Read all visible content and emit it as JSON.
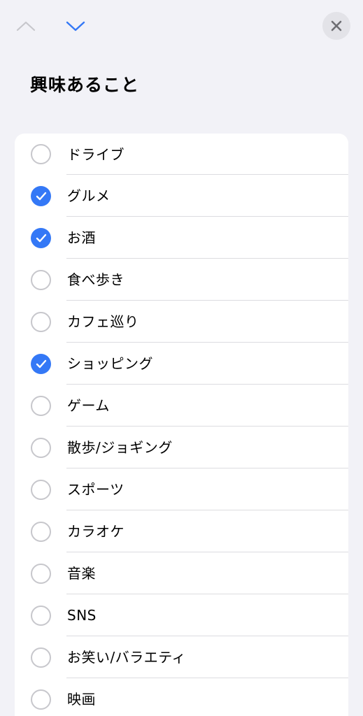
{
  "title": "興味あること",
  "nav": {
    "up_icon": "chevron-up-icon",
    "down_icon": "chevron-down-icon",
    "close_icon": "close-icon"
  },
  "colors": {
    "background": "#f2f2f7",
    "accent": "#3478f6",
    "chevron_disabled": "#c7c7cc",
    "card": "#ffffff"
  },
  "items": [
    {
      "label": "ドライブ",
      "checked": false
    },
    {
      "label": "グルメ",
      "checked": true
    },
    {
      "label": "お酒",
      "checked": true
    },
    {
      "label": "食べ歩き",
      "checked": false
    },
    {
      "label": "カフェ巡り",
      "checked": false
    },
    {
      "label": "ショッピング",
      "checked": true
    },
    {
      "label": "ゲーム",
      "checked": false
    },
    {
      "label": "散歩/ジョギング",
      "checked": false
    },
    {
      "label": "スポーツ",
      "checked": false
    },
    {
      "label": "カラオケ",
      "checked": false
    },
    {
      "label": "音楽",
      "checked": false
    },
    {
      "label": "SNS",
      "checked": false
    },
    {
      "label": "お笑い/バラエティ",
      "checked": false
    },
    {
      "label": "映画",
      "checked": false
    }
  ]
}
